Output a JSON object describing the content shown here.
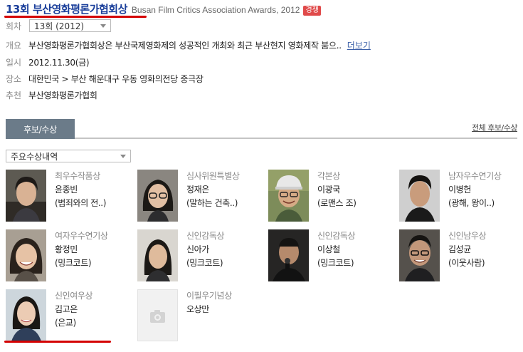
{
  "header": {
    "title_ko": "13회 부산영화평론가협회상",
    "title_en": "Busan Film Critics Association Awards, 2012",
    "badge": "경쟁"
  },
  "info": {
    "round_label": "회차",
    "round_value": "13회 (2012)",
    "overview_label": "개요",
    "overview_value": "부산영화평론가협회상은 부산국제영화제의 성공적인 개최와 최근 부산현지 영화제작 붐으..",
    "more_label": "더보기",
    "date_label": "일시",
    "date_value": "2012.11.30(금)",
    "place_label": "장소",
    "place_value": "대한민국 > 부산 해운대구 우동 영화의전당 중극장",
    "host_label": "추천",
    "host_value": "부산영화평론가협회"
  },
  "tabs": {
    "active": "후보/수상",
    "all_link": "전체 후보/수상"
  },
  "filter": {
    "selected": "주요수상내역"
  },
  "awards": [
    {
      "award": "최우수작품상",
      "name": "윤종빈",
      "work": "(범죄와의 전..)",
      "photo": "portrait-1"
    },
    {
      "award": "심사위원특별상",
      "name": "정재은",
      "work": "(말하는 건축..)",
      "photo": "portrait-2"
    },
    {
      "award": "각본상",
      "name": "이광국",
      "work": "(로맨스 조)",
      "photo": "portrait-3"
    },
    {
      "award": "남자우수연기상",
      "name": "이병헌",
      "work": "(광해, 왕이..)",
      "photo": "portrait-4"
    },
    {
      "award": "여자우수연기상",
      "name": "황정민",
      "work": "(밍크코트)",
      "photo": "portrait-5"
    },
    {
      "award": "신인감독상",
      "name": "신아가",
      "work": "(밍크코트)",
      "photo": "portrait-6"
    },
    {
      "award": "신인감독상",
      "name": "이상철",
      "work": "(밍크코트)",
      "photo": "portrait-7"
    },
    {
      "award": "신인남우상",
      "name": "김성균",
      "work": "(이웃사람)",
      "photo": "portrait-8"
    },
    {
      "award": "신인여우상",
      "name": "김고은",
      "work": "(은교)",
      "photo": "portrait-9"
    },
    {
      "award": "이필우기념상",
      "name": "오상만",
      "work": "",
      "photo": "camera-placeholder-icon"
    }
  ],
  "colors": {
    "title": "#1a3e9a",
    "badge": "#e04a4a",
    "tab": "#6b7b89",
    "underline": "#d40000"
  }
}
